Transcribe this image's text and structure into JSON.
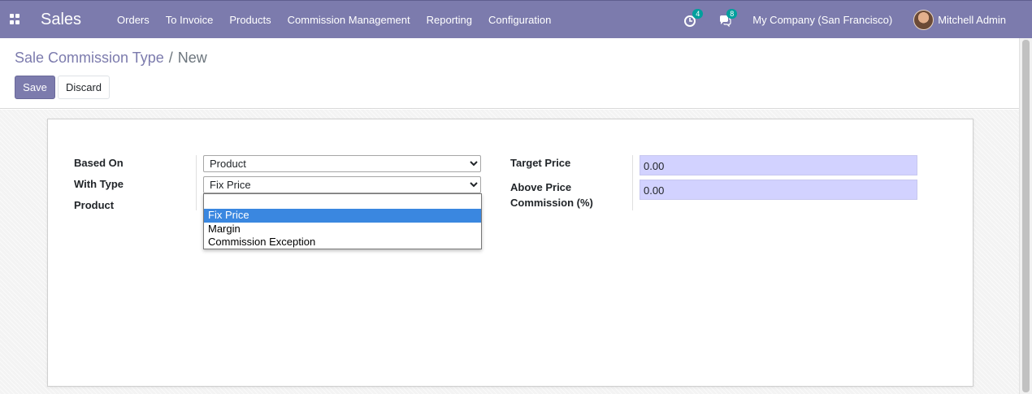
{
  "app": {
    "title": "Sales"
  },
  "menu": [
    "Orders",
    "To Invoice",
    "Products",
    "Commission Management",
    "Reporting",
    "Configuration"
  ],
  "systray": {
    "activities_count": "4",
    "messages_count": "8",
    "company": "My Company (San Francisco)",
    "user": "Mitchell Admin"
  },
  "breadcrumb": {
    "parent": "Sale Commission Type",
    "separator": "/",
    "current": "New"
  },
  "buttons": {
    "save": "Save",
    "discard": "Discard"
  },
  "form": {
    "based_on": {
      "label": "Based On",
      "value": "Product"
    },
    "with_type": {
      "label": "With Type",
      "value": "Fix Price"
    },
    "product": {
      "label": "Product"
    },
    "target_price": {
      "label": "Target Price",
      "value": "0.00"
    },
    "above_price_commission": {
      "label_line1": "Above Price",
      "label_line2": "Commission (%)",
      "value": "0.00"
    }
  },
  "dropdown": {
    "options": [
      "",
      "Fix Price",
      "Margin",
      "Commission Exception"
    ],
    "selected": "Fix Price"
  },
  "colors": {
    "navbar": "#7c7bad",
    "primary": "#7c7bad",
    "selection": "#3a87e0",
    "input_highlight": "#d2d2ff",
    "badge": "#00a09d"
  }
}
